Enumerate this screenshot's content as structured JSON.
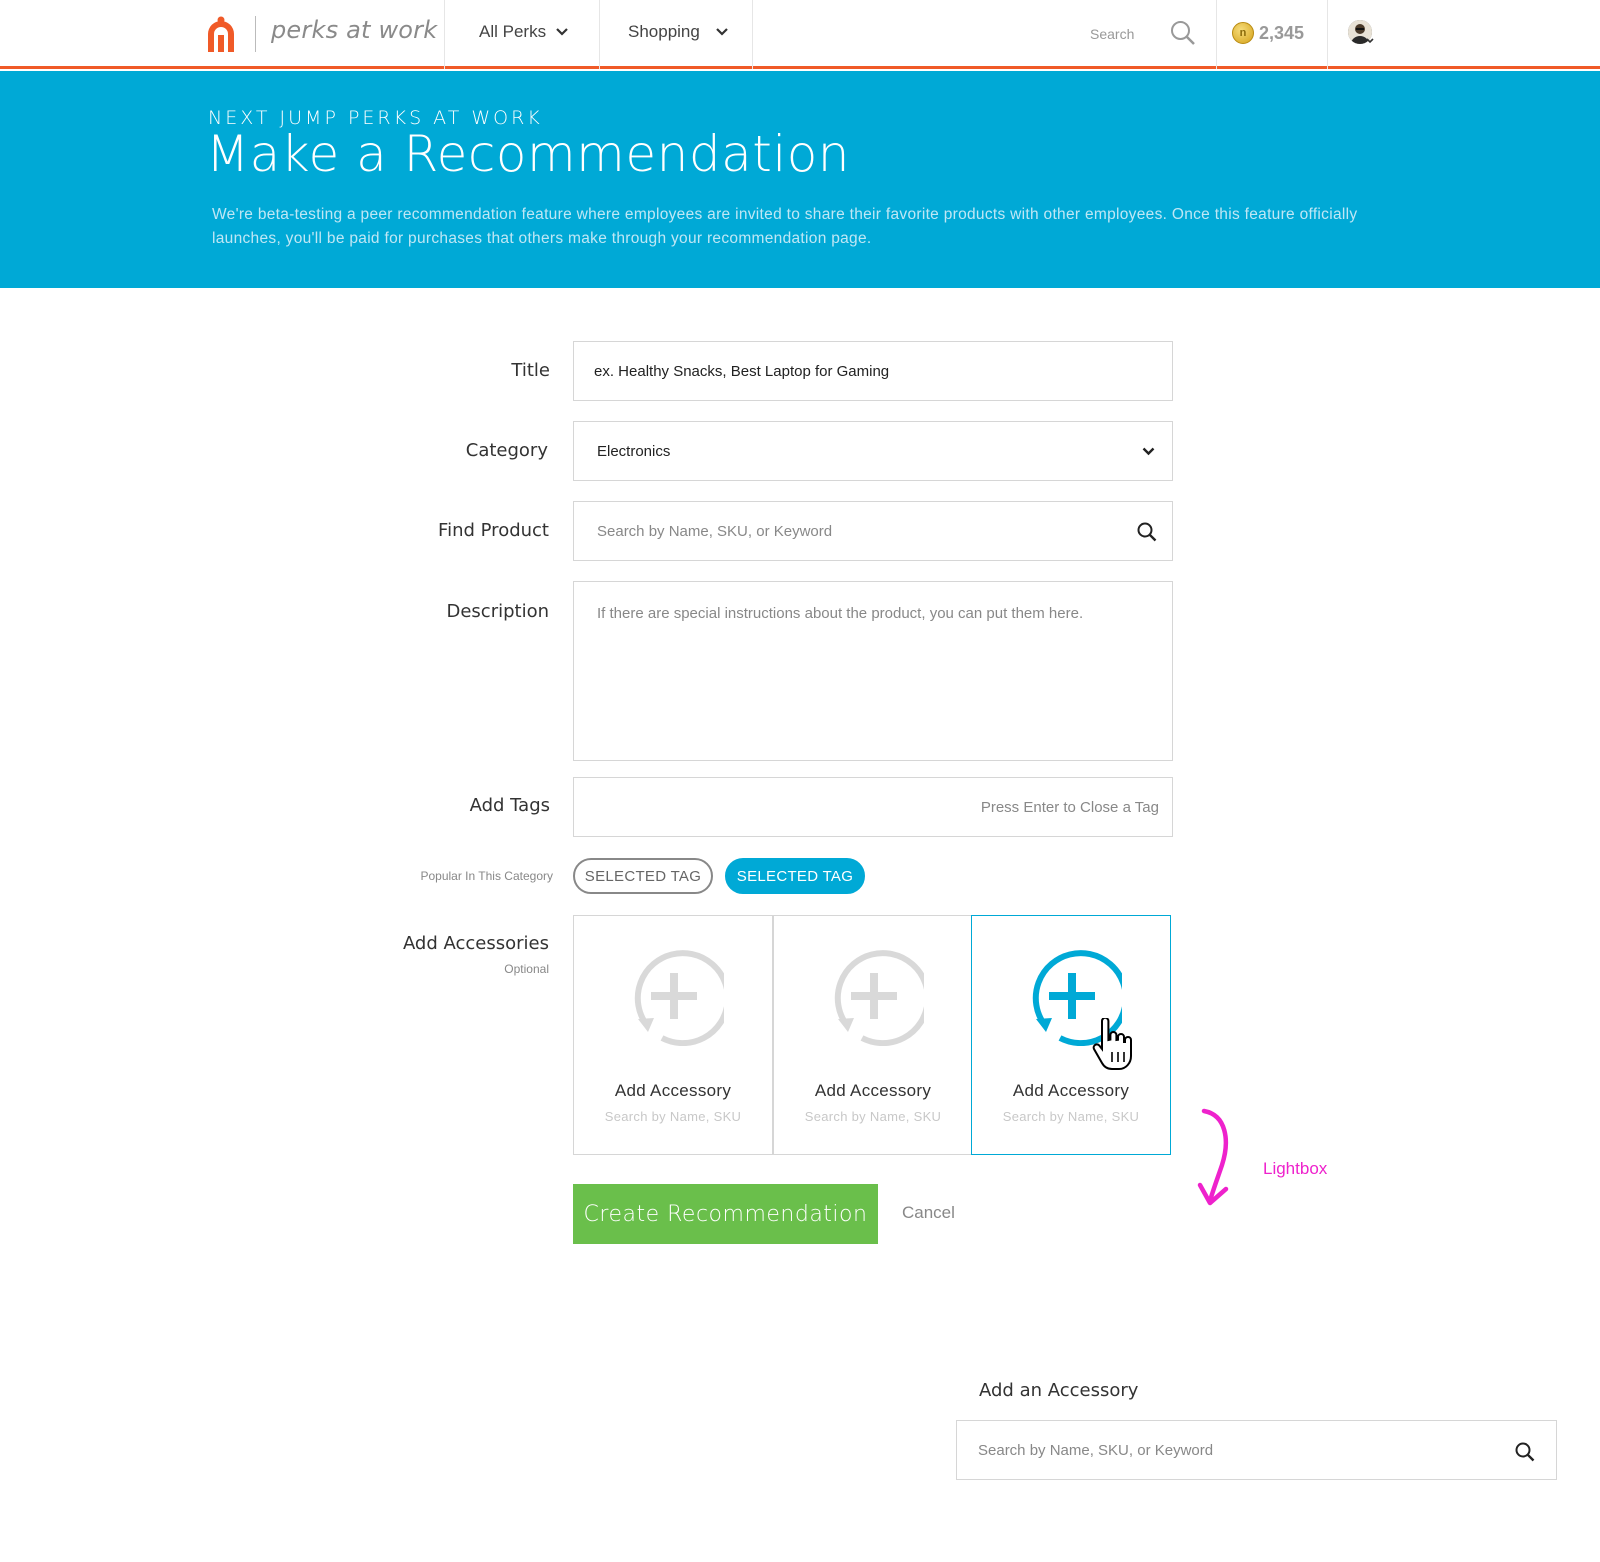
{
  "nav": {
    "brand": "perks at work",
    "all_perks": "All Perks",
    "shopping": "Shopping",
    "search_label": "Search",
    "points": "2,345"
  },
  "hero": {
    "kicker": "NEXT JUMP PERKS AT WORK",
    "title": "Make a Recommendation",
    "description": "We're beta-testing a peer recommendation feature where employees are invited to share their favorite products with other employees. Once this feature officially launches, you'll be paid for purchases that others make through your recommendation page."
  },
  "form": {
    "title_label": "Title",
    "title_value": "ex. Healthy Snacks, Best Laptop for Gaming",
    "category_label": "Category",
    "category_value": "Electronics",
    "find_label": "Find Product",
    "find_placeholder": "Search by Name, SKU, or Keyword",
    "description_label": "Description",
    "description_placeholder": "If there are special instructions about the product, you can put them here.",
    "tags_label": "Add Tags",
    "tags_hint": "Press Enter to Close a Tag",
    "popular_label": "Popular In This Category",
    "tags": [
      "SELECTED TAG",
      "SELECTED TAG"
    ],
    "accessories_label": "Add Accessories",
    "accessories_optional": "Optional",
    "accessories": [
      {
        "title": "Add Accessory",
        "subtitle": "Search by Name, SKU"
      },
      {
        "title": "Add Accessory",
        "subtitle": "Search by Name, SKU"
      },
      {
        "title": "Add Accessory",
        "subtitle": "Search by Name, SKU"
      }
    ],
    "create_button": "Create Recommendation",
    "cancel_button": "Cancel"
  },
  "annotation": {
    "label": "Lightbox"
  },
  "lightbox": {
    "title": "Add an Accessory",
    "search_placeholder": "Search by Name, SKU, or Keyword"
  },
  "colors": {
    "brand_orange": "#f05a28",
    "hero_blue": "#00a9d6",
    "create_green": "#6abf4b",
    "annotation_magenta": "#ee22cc"
  }
}
